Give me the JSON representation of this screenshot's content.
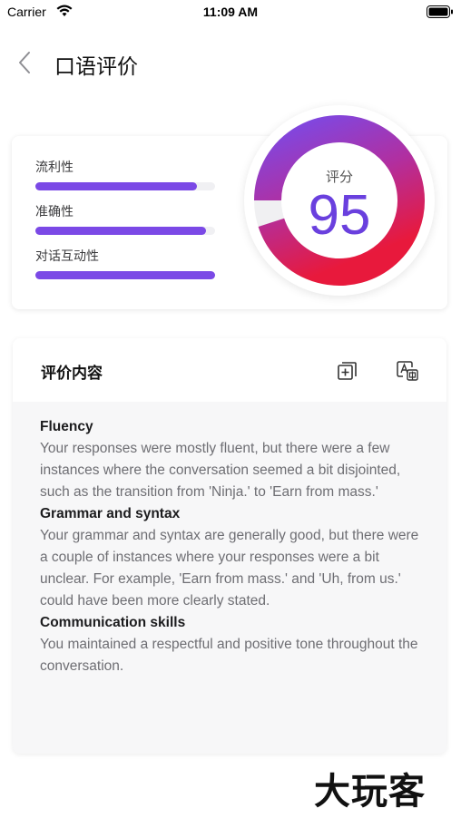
{
  "status_bar": {
    "carrier": "Carrier",
    "time": "11:09 AM"
  },
  "nav": {
    "title": "口语评价"
  },
  "score": {
    "label": "评分",
    "value": "95",
    "metrics": [
      {
        "label": "流利性",
        "fraction": 0.9
      },
      {
        "label": "准确性",
        "fraction": 0.95
      },
      {
        "label": "对话互动性",
        "fraction": 1.0
      }
    ],
    "ring_colors": {
      "start": "#7b49e6",
      "mid": "#b12fa0",
      "end": "#e8193c",
      "track": "#f0f0f2"
    }
  },
  "evaluation": {
    "title": "评价内容",
    "sections": [
      {
        "heading": "Fluency",
        "text": "Your responses were mostly fluent, but there were a few instances where the conversation seemed a bit disjointed, such as the transition from 'Ninja.' to 'Earn from mass.'"
      },
      {
        "heading": "Grammar and syntax",
        "text": "Your grammar and syntax are generally good, but there were a couple of instances where your responses were a bit unclear. For example, 'Earn from mass.' and 'Uh, from us.' could have been more clearly stated."
      },
      {
        "heading": "Communication skills",
        "text": "You maintained a respectful and positive tone throughout the conversation."
      }
    ]
  },
  "watermark": "大玩客"
}
